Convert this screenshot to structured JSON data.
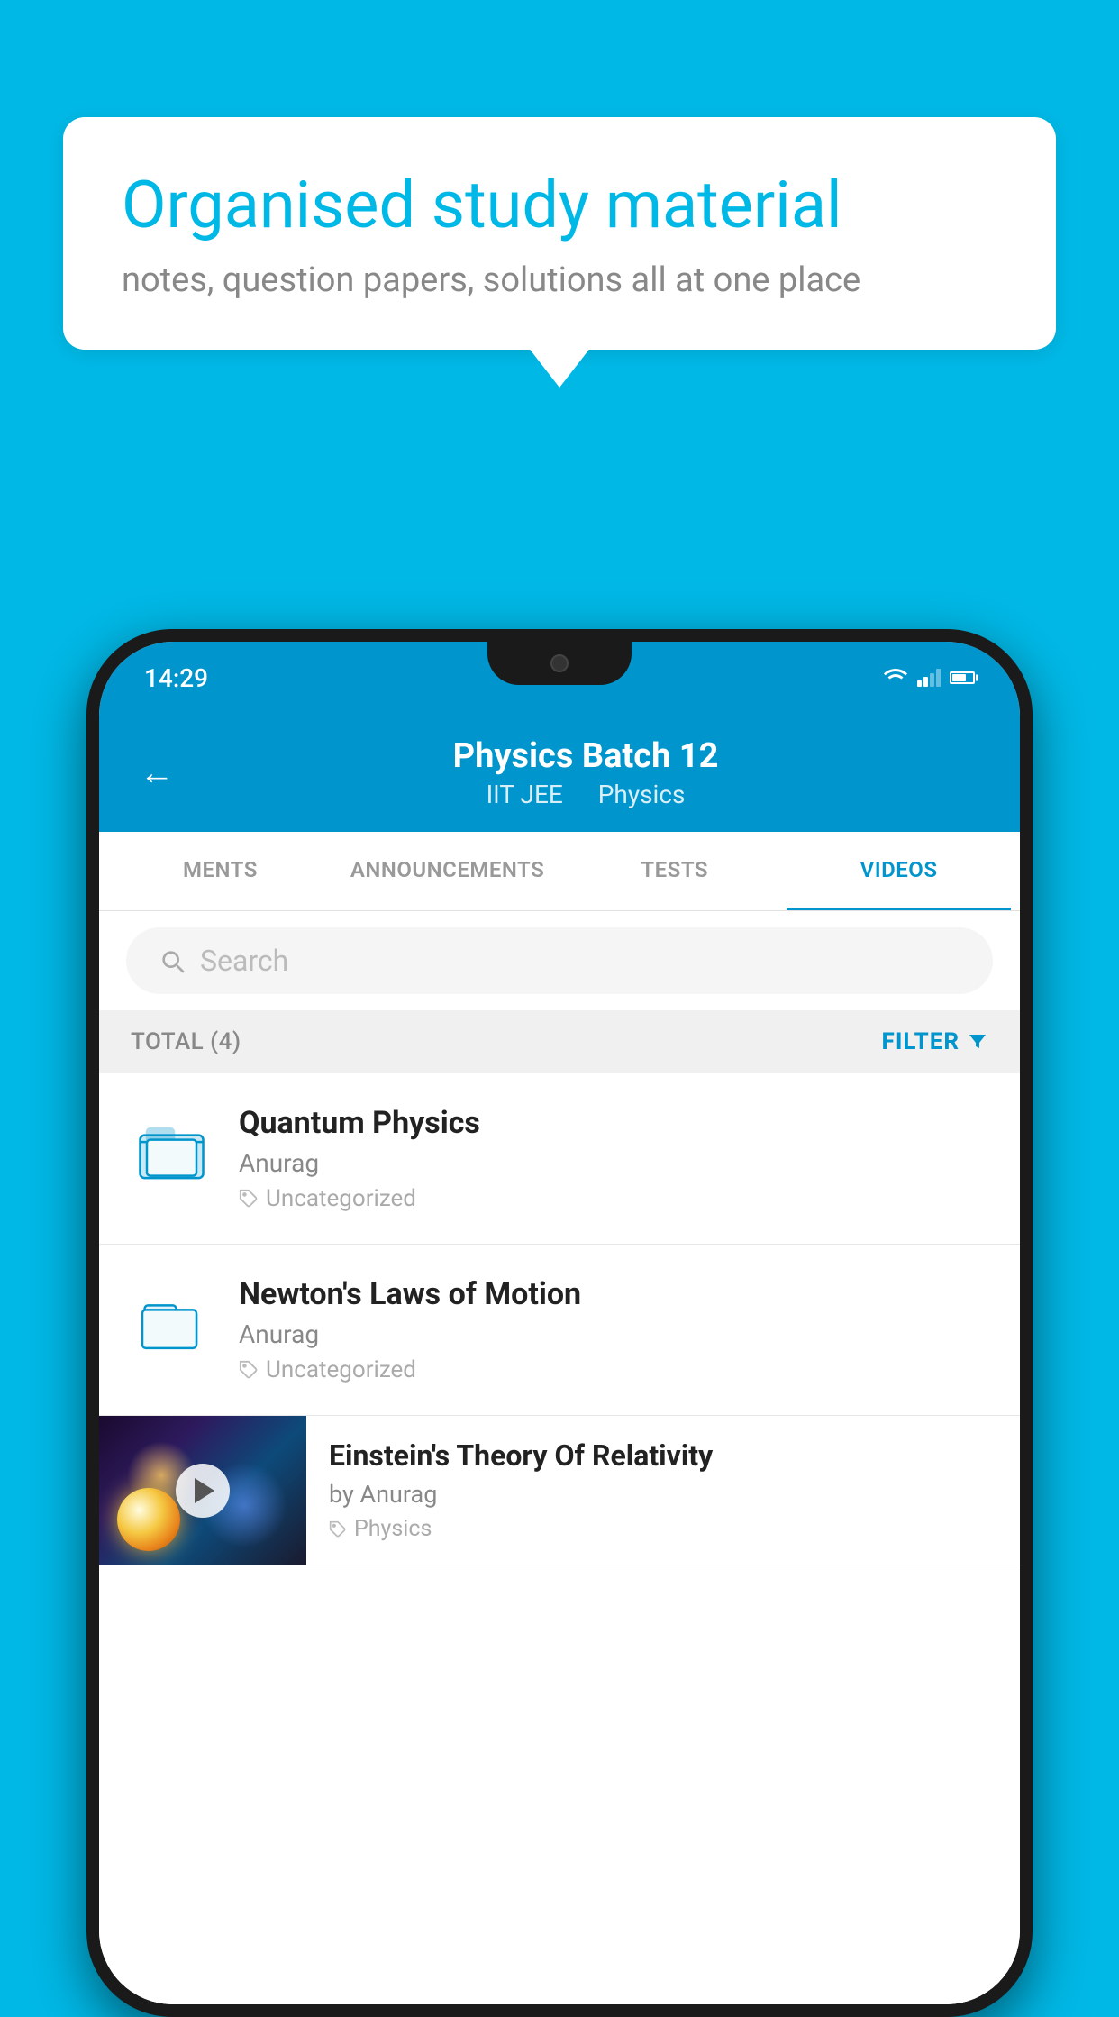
{
  "background": {
    "color": "#00B8E6"
  },
  "speech_bubble": {
    "title": "Organised study material",
    "subtitle": "notes, question papers, solutions all at one place"
  },
  "phone": {
    "status_bar": {
      "time": "14:29"
    },
    "header": {
      "title": "Physics Batch 12",
      "subtitle_part1": "IIT JEE",
      "subtitle_part2": "Physics",
      "back_label": "←"
    },
    "tabs": [
      {
        "label": "MENTS",
        "active": false
      },
      {
        "label": "ANNOUNCEMENTS",
        "active": false
      },
      {
        "label": "TESTS",
        "active": false
      },
      {
        "label": "VIDEOS",
        "active": true
      }
    ],
    "search": {
      "placeholder": "Search"
    },
    "filter": {
      "total_label": "TOTAL (4)",
      "filter_label": "FILTER"
    },
    "items": [
      {
        "title": "Quantum Physics",
        "author": "Anurag",
        "tag": "Uncategorized",
        "type": "folder"
      },
      {
        "title": "Newton's Laws of Motion",
        "author": "Anurag",
        "tag": "Uncategorized",
        "type": "folder"
      },
      {
        "title": "Einstein's Theory Of Relativity",
        "author": "by Anurag",
        "tag": "Physics",
        "type": "video"
      }
    ]
  }
}
